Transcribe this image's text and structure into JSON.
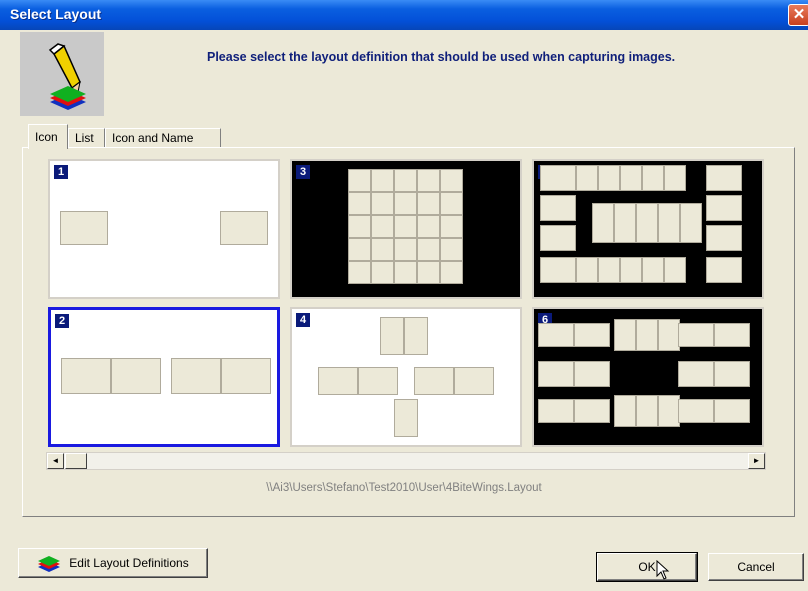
{
  "window": {
    "title": "Select Layout",
    "close_glyph": "✕"
  },
  "header": {
    "prompt": "Please select the layout definition that should be used when capturing images.",
    "icon": "pencil-layers-icon"
  },
  "tabs": [
    {
      "label": "Icon",
      "active": true
    },
    {
      "label": "List",
      "active": false
    },
    {
      "label": "Icon and Name",
      "active": false
    }
  ],
  "layouts": [
    {
      "number": "1",
      "background": "white",
      "selected": false
    },
    {
      "number": "2",
      "background": "white",
      "selected": true
    },
    {
      "number": "3",
      "background": "black",
      "selected": false
    },
    {
      "number": "4",
      "background": "white",
      "selected": false
    },
    {
      "number": "5",
      "background": "black",
      "selected": false
    },
    {
      "number": "6",
      "background": "black",
      "selected": false
    }
  ],
  "path": "\\\\Ai3\\Users\\Stefano\\Test2010\\User\\4BiteWings.Layout",
  "buttons": {
    "edit_layouts": "Edit Layout Definitions",
    "ok": "OK",
    "cancel": "Cancel"
  },
  "scrollbar": {
    "left_glyph": "◄",
    "right_glyph": "►"
  },
  "colors": {
    "selection_border": "#1a1ae0",
    "prompt_text": "#0f1f7a",
    "title_bar": "#0350d8"
  }
}
